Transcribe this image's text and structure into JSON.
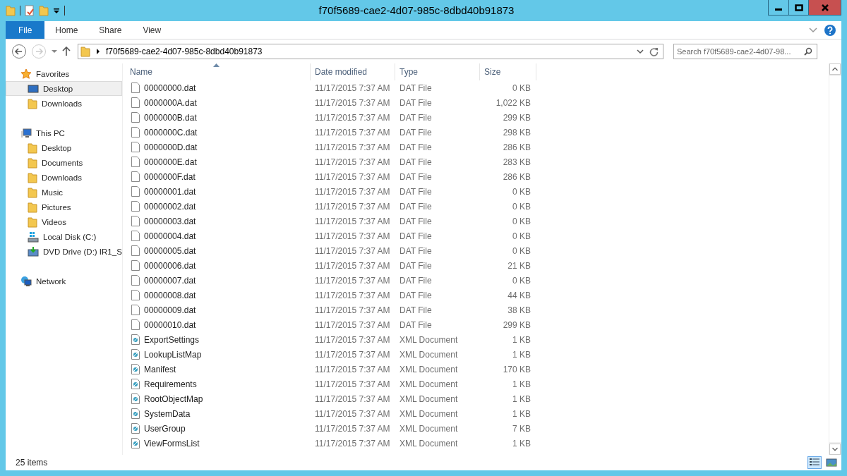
{
  "window": {
    "title": "f70f5689-cae2-4d07-985c-8dbd40b91873"
  },
  "ribbon_tabs": [
    {
      "label": "File",
      "selected": true
    },
    {
      "label": "Home",
      "selected": false
    },
    {
      "label": "Share",
      "selected": false
    },
    {
      "label": "View",
      "selected": false
    }
  ],
  "address_bar": {
    "path": "f70f5689-cae2-4d07-985c-8dbd40b91873"
  },
  "search": {
    "placeholder": "Search f70f5689-cae2-4d07-98..."
  },
  "sidebar": {
    "items": [
      {
        "label": "Favorites",
        "selected": false,
        "children": [
          {
            "label": "Desktop",
            "selected": true
          },
          {
            "label": "Downloads",
            "selected": false
          }
        ]
      },
      {
        "label": "This PC",
        "selected": false,
        "children": [
          {
            "label": "Desktop",
            "selected": false
          },
          {
            "label": "Documents",
            "selected": false
          },
          {
            "label": "Downloads",
            "selected": false
          },
          {
            "label": "Music",
            "selected": false
          },
          {
            "label": "Pictures",
            "selected": false
          },
          {
            "label": "Videos",
            "selected": false
          },
          {
            "label": "Local Disk (C:)",
            "selected": false
          },
          {
            "label": "DVD Drive (D:) IR1_S",
            "selected": false
          }
        ]
      },
      {
        "label": "Network",
        "selected": false
      }
    ]
  },
  "table": {
    "columns": [
      "Name",
      "Date modified",
      "Type",
      "Size"
    ],
    "rows": [
      {
        "name": "00000000.dat",
        "date": "11/17/2015 7:37 AM",
        "type": "DAT File",
        "size": "0 KB",
        "kind": "dat"
      },
      {
        "name": "0000000A.dat",
        "date": "11/17/2015 7:37 AM",
        "type": "DAT File",
        "size": "1,022 KB",
        "kind": "dat"
      },
      {
        "name": "0000000B.dat",
        "date": "11/17/2015 7:37 AM",
        "type": "DAT File",
        "size": "299 KB",
        "kind": "dat"
      },
      {
        "name": "0000000C.dat",
        "date": "11/17/2015 7:37 AM",
        "type": "DAT File",
        "size": "298 KB",
        "kind": "dat"
      },
      {
        "name": "0000000D.dat",
        "date": "11/17/2015 7:37 AM",
        "type": "DAT File",
        "size": "286 KB",
        "kind": "dat"
      },
      {
        "name": "0000000E.dat",
        "date": "11/17/2015 7:37 AM",
        "type": "DAT File",
        "size": "283 KB",
        "kind": "dat"
      },
      {
        "name": "0000000F.dat",
        "date": "11/17/2015 7:37 AM",
        "type": "DAT File",
        "size": "286 KB",
        "kind": "dat"
      },
      {
        "name": "00000001.dat",
        "date": "11/17/2015 7:37 AM",
        "type": "DAT File",
        "size": "0 KB",
        "kind": "dat"
      },
      {
        "name": "00000002.dat",
        "date": "11/17/2015 7:37 AM",
        "type": "DAT File",
        "size": "0 KB",
        "kind": "dat"
      },
      {
        "name": "00000003.dat",
        "date": "11/17/2015 7:37 AM",
        "type": "DAT File",
        "size": "0 KB",
        "kind": "dat"
      },
      {
        "name": "00000004.dat",
        "date": "11/17/2015 7:37 AM",
        "type": "DAT File",
        "size": "0 KB",
        "kind": "dat"
      },
      {
        "name": "00000005.dat",
        "date": "11/17/2015 7:37 AM",
        "type": "DAT File",
        "size": "0 KB",
        "kind": "dat"
      },
      {
        "name": "00000006.dat",
        "date": "11/17/2015 7:37 AM",
        "type": "DAT File",
        "size": "21 KB",
        "kind": "dat"
      },
      {
        "name": "00000007.dat",
        "date": "11/17/2015 7:37 AM",
        "type": "DAT File",
        "size": "0 KB",
        "kind": "dat"
      },
      {
        "name": "00000008.dat",
        "date": "11/17/2015 7:37 AM",
        "type": "DAT File",
        "size": "44 KB",
        "kind": "dat"
      },
      {
        "name": "00000009.dat",
        "date": "11/17/2015 7:37 AM",
        "type": "DAT File",
        "size": "38 KB",
        "kind": "dat"
      },
      {
        "name": "00000010.dat",
        "date": "11/17/2015 7:37 AM",
        "type": "DAT File",
        "size": "299 KB",
        "kind": "dat"
      },
      {
        "name": "ExportSettings",
        "date": "11/17/2015 7:37 AM",
        "type": "XML Document",
        "size": "1 KB",
        "kind": "xml"
      },
      {
        "name": "LookupListMap",
        "date": "11/17/2015 7:37 AM",
        "type": "XML Document",
        "size": "1 KB",
        "kind": "xml"
      },
      {
        "name": "Manifest",
        "date": "11/17/2015 7:37 AM",
        "type": "XML Document",
        "size": "170 KB",
        "kind": "xml"
      },
      {
        "name": "Requirements",
        "date": "11/17/2015 7:37 AM",
        "type": "XML Document",
        "size": "1 KB",
        "kind": "xml"
      },
      {
        "name": "RootObjectMap",
        "date": "11/17/2015 7:37 AM",
        "type": "XML Document",
        "size": "1 KB",
        "kind": "xml"
      },
      {
        "name": "SystemData",
        "date": "11/17/2015 7:37 AM",
        "type": "XML Document",
        "size": "1 KB",
        "kind": "xml"
      },
      {
        "name": "UserGroup",
        "date": "11/17/2015 7:37 AM",
        "type": "XML Document",
        "size": "7 KB",
        "kind": "xml"
      },
      {
        "name": "ViewFormsList",
        "date": "11/17/2015 7:37 AM",
        "type": "XML Document",
        "size": "1 KB",
        "kind": "xml"
      }
    ]
  },
  "status_bar": {
    "count": "25 items",
    "views": [
      {
        "selected": true
      },
      {
        "selected": false
      }
    ]
  }
}
